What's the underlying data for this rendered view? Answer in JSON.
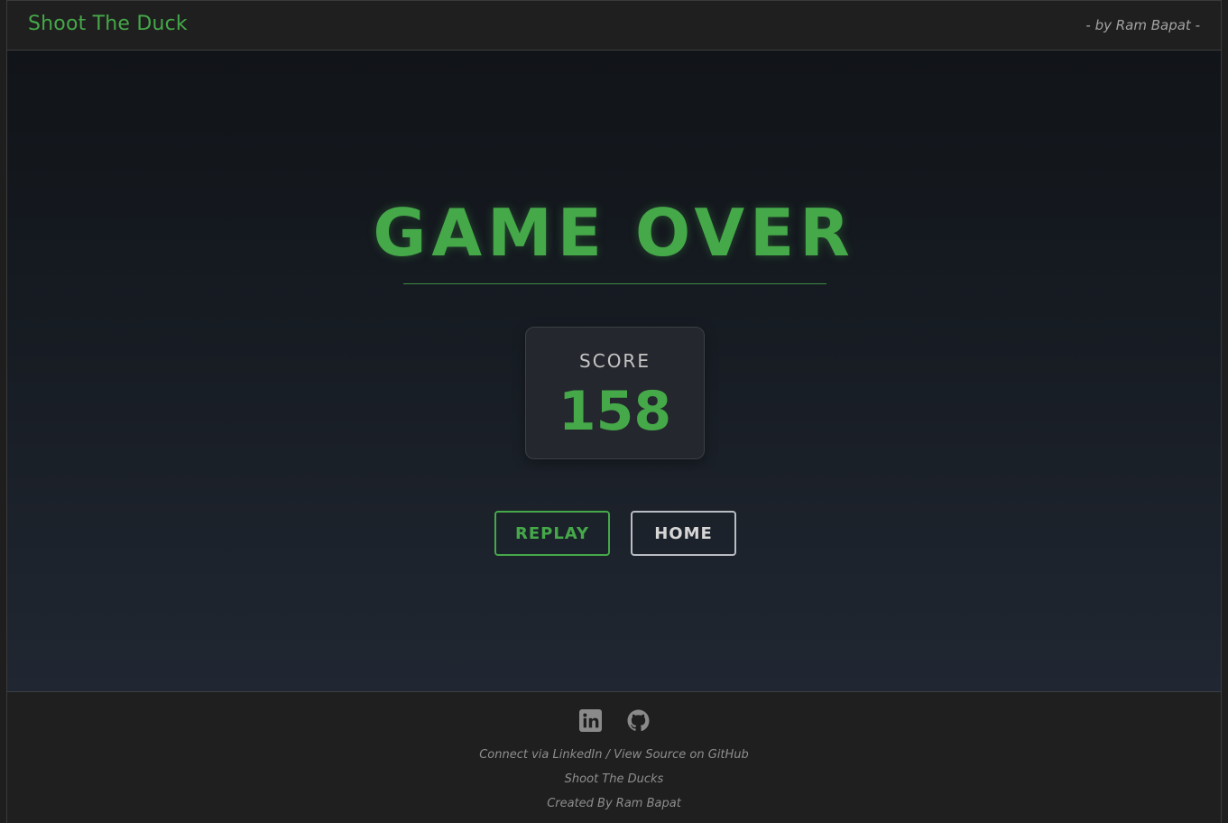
{
  "header": {
    "brand": "Shoot The Duck",
    "byline": "- by Ram Bapat -"
  },
  "game_over": {
    "title": "GAME OVER",
    "score_label": "SCORE",
    "score_value": "158"
  },
  "buttons": {
    "replay": "REPLAY",
    "home": "HOME"
  },
  "footer": {
    "icons": [
      "linkedin-icon",
      "github-icon"
    ],
    "connect_text": "Connect via LinkedIn / View Source on GitHub",
    "app_name": "Shoot The Ducks",
    "credit": "Created By Ram Bapat"
  },
  "colors": {
    "accent": "#45a849",
    "background_top": "#111418",
    "background_bottom": "#202732",
    "bar": "#1f1f1f"
  }
}
